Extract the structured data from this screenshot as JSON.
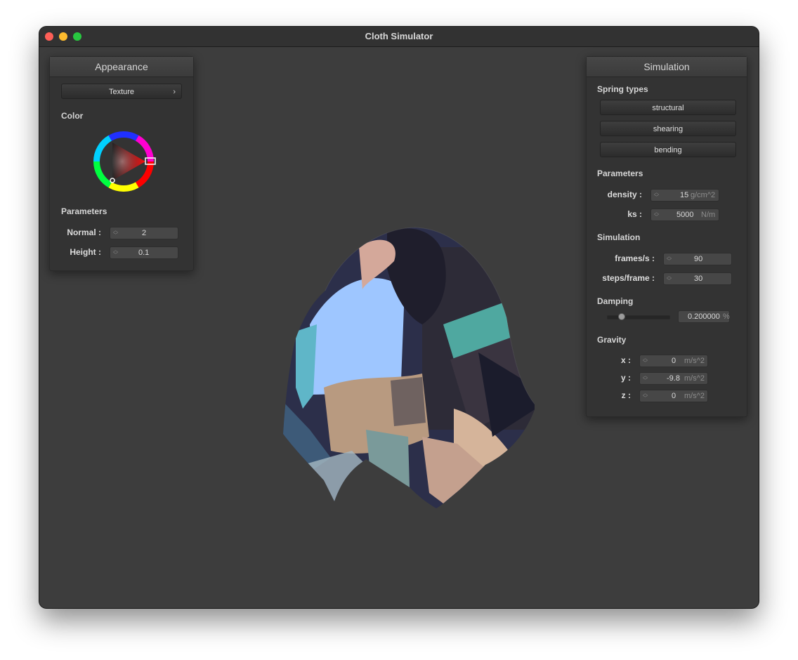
{
  "window": {
    "title": "Cloth Simulator"
  },
  "appearance": {
    "title": "Appearance",
    "texture_button": "Texture",
    "color_label": "Color",
    "parameters_label": "Parameters",
    "normal": {
      "label": "Normal :",
      "value": "2"
    },
    "height": {
      "label": "Height :",
      "value": "0.1"
    }
  },
  "simulation": {
    "title": "Simulation",
    "spring_types_label": "Spring types",
    "spring_buttons": [
      "structural",
      "shearing",
      "bending"
    ],
    "parameters_label": "Parameters",
    "density": {
      "label": "density :",
      "value": "15",
      "unit": "g/cm^2"
    },
    "ks": {
      "label": "ks :",
      "value": "5000",
      "unit": "N/m"
    },
    "simulation_label": "Simulation",
    "fps": {
      "label": "frames/s :",
      "value": "90"
    },
    "steps": {
      "label": "steps/frame :",
      "value": "30"
    },
    "damping_label": "Damping",
    "damping": {
      "value": "0.200000",
      "unit": "%",
      "slider_fraction": 0.2
    },
    "gravity_label": "Gravity",
    "gravity": {
      "x": {
        "label": "x :",
        "value": "0",
        "unit": "m/s^2"
      },
      "y": {
        "label": "y :",
        "value": "-9.8",
        "unit": "m/s^2"
      },
      "z": {
        "label": "z :",
        "value": "0",
        "unit": "m/s^2"
      }
    }
  }
}
